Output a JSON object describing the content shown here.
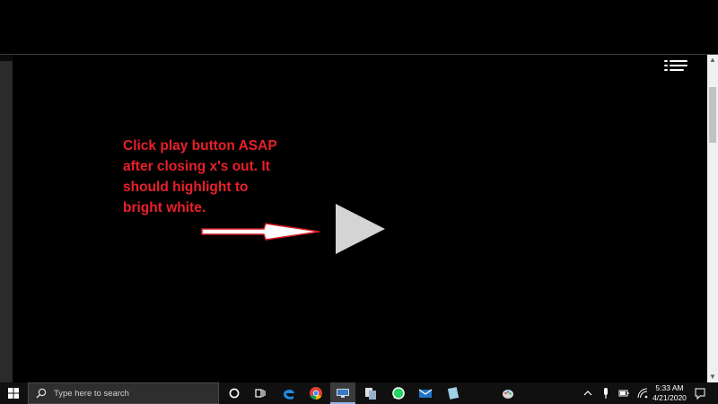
{
  "annotation": {
    "text": "Click play button ASAP\nafter closing x's out. It\nshould highlight to\nbright white.",
    "color": "#e8202a"
  },
  "player": {
    "play_icon": "play-icon",
    "menu_icon": "list-menu-icon",
    "arrow_icon": "arrow-right-icon"
  },
  "taskbar": {
    "search_placeholder": "Type here to search",
    "apps": [
      "cortana-icon",
      "task-view-icon",
      "edge-icon",
      "chrome-icon",
      "remote-desktop-icon",
      "file-copy-icon",
      "whatsapp-icon",
      "mail-icon",
      "tablet-app-icon",
      "paint-icon"
    ]
  },
  "tray": {
    "icons": [
      "chevron-up-icon",
      "microphone-icon",
      "battery-icon",
      "wifi-icon",
      "notification-icon"
    ],
    "time": "5:33 AM",
    "date": "4/21/2020"
  }
}
